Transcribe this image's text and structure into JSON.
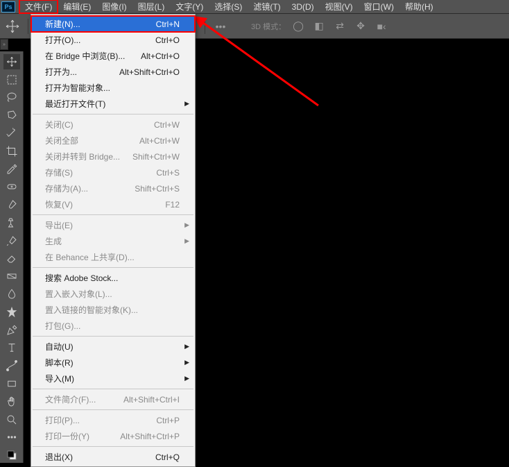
{
  "app": {
    "logo": "Ps"
  },
  "menubar": [
    {
      "label": "文件(F)",
      "highlighted": true
    },
    {
      "label": "编辑(E)"
    },
    {
      "label": "图像(I)"
    },
    {
      "label": "图层(L)"
    },
    {
      "label": "文字(Y)"
    },
    {
      "label": "选择(S)"
    },
    {
      "label": "滤镜(T)"
    },
    {
      "label": "3D(D)"
    },
    {
      "label": "视图(V)"
    },
    {
      "label": "窗口(W)"
    },
    {
      "label": "帮助(H)"
    }
  ],
  "optionsbar": {
    "mode_label": "3D 模式："
  },
  "tools": [
    "move",
    "marquee",
    "lasso",
    "polygonal-lasso",
    "wand",
    "crop",
    "eyedropper",
    "healing",
    "brush",
    "clone",
    "history-brush",
    "eraser",
    "gradient",
    "blur",
    "dodge",
    "pen",
    "type",
    "path",
    "rectangle",
    "hand",
    "zoom",
    "ellipsis",
    "fg-bg"
  ],
  "dropdown": [
    {
      "label": "新建(N)...",
      "shortcut": "Ctrl+N",
      "highlight": true
    },
    {
      "label": "打开(O)...",
      "shortcut": "Ctrl+O"
    },
    {
      "label": "在 Bridge 中浏览(B)...",
      "shortcut": "Alt+Ctrl+O"
    },
    {
      "label": "打开为...",
      "shortcut": "Alt+Shift+Ctrl+O"
    },
    {
      "label": "打开为智能对象..."
    },
    {
      "label": "最近打开文件(T)",
      "submenu": true
    },
    {
      "sep": true
    },
    {
      "label": "关闭(C)",
      "shortcut": "Ctrl+W",
      "disabled": true
    },
    {
      "label": "关闭全部",
      "shortcut": "Alt+Ctrl+W",
      "disabled": true
    },
    {
      "label": "关闭并转到 Bridge...",
      "shortcut": "Shift+Ctrl+W",
      "disabled": true
    },
    {
      "label": "存储(S)",
      "shortcut": "Ctrl+S",
      "disabled": true
    },
    {
      "label": "存储为(A)...",
      "shortcut": "Shift+Ctrl+S",
      "disabled": true
    },
    {
      "label": "恢复(V)",
      "shortcut": "F12",
      "disabled": true
    },
    {
      "sep": true
    },
    {
      "label": "导出(E)",
      "submenu": true,
      "disabled": true
    },
    {
      "label": "生成",
      "submenu": true,
      "disabled": true
    },
    {
      "label": "在 Behance 上共享(D)...",
      "disabled": true
    },
    {
      "sep": true
    },
    {
      "label": "搜索 Adobe Stock..."
    },
    {
      "label": "置入嵌入对象(L)...",
      "disabled": true
    },
    {
      "label": "置入链接的智能对象(K)...",
      "disabled": true
    },
    {
      "label": "打包(G)...",
      "disabled": true
    },
    {
      "sep": true
    },
    {
      "label": "自动(U)",
      "submenu": true
    },
    {
      "label": "脚本(R)",
      "submenu": true
    },
    {
      "label": "导入(M)",
      "submenu": true
    },
    {
      "sep": true
    },
    {
      "label": "文件简介(F)...",
      "shortcut": "Alt+Shift+Ctrl+I",
      "disabled": true
    },
    {
      "sep": true
    },
    {
      "label": "打印(P)...",
      "shortcut": "Ctrl+P",
      "disabled": true
    },
    {
      "label": "打印一份(Y)",
      "shortcut": "Alt+Shift+Ctrl+P",
      "disabled": true
    },
    {
      "sep": true
    },
    {
      "label": "退出(X)",
      "shortcut": "Ctrl+Q"
    }
  ]
}
